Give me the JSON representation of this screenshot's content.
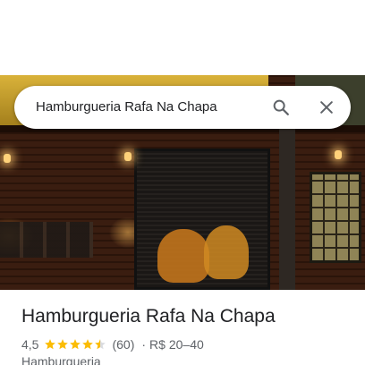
{
  "search": {
    "query": "Hamburgueria Rafa Na Chapa",
    "search_icon": "search-icon",
    "close_icon": "close-icon"
  },
  "place": {
    "name": "Hamburgueria Rafa Na Chapa",
    "rating": "4,5",
    "rating_value": 4.5,
    "rating_max": 5,
    "reviews": "(60)",
    "separator": "·",
    "price": "R$ 20–40",
    "category": "Hamburgueria"
  },
  "colors": {
    "star": "#fbbc04",
    "star_empty": "#dadce0",
    "text_primary": "#202124",
    "text_secondary": "#5f6368",
    "icon": "#5f6368"
  }
}
